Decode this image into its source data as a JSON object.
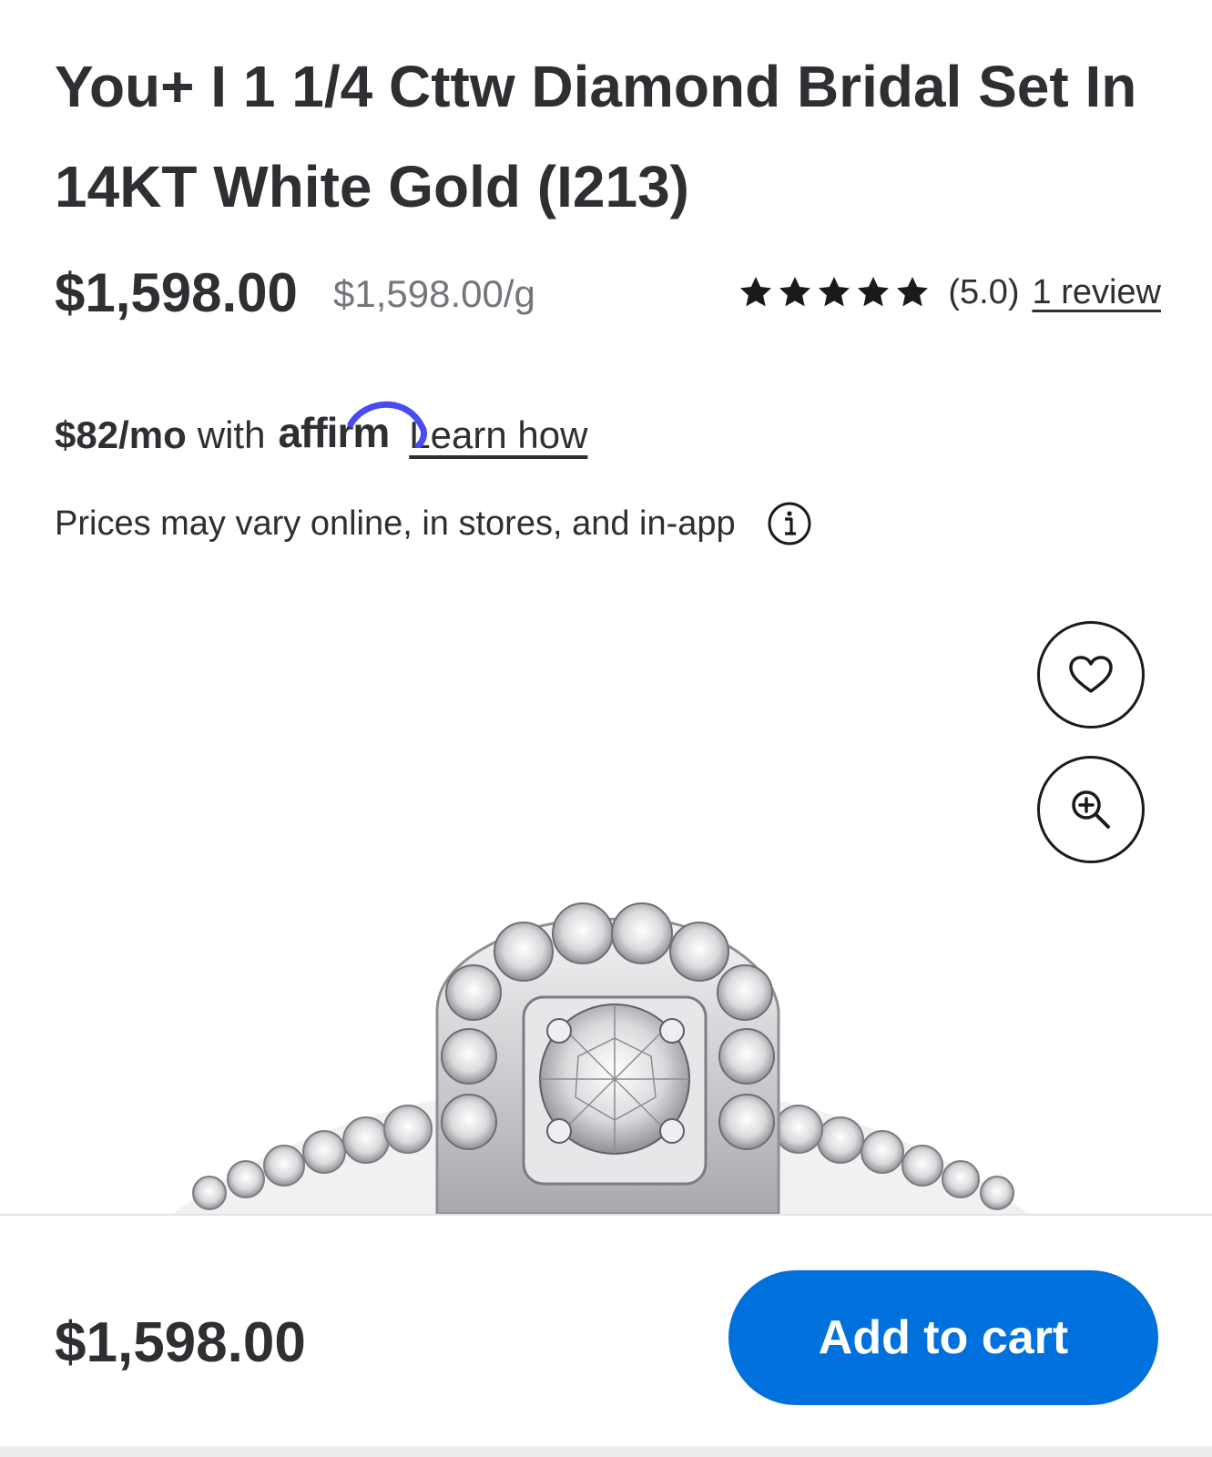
{
  "product": {
    "title": "You+ I 1 1/4 Cttw Diamond Bridal Set In 14KT White Gold (I213)",
    "price": "$1,598.00",
    "unit_price": "$1,598.00/g"
  },
  "rating": {
    "stars": 5,
    "max_stars": 5,
    "value_text": "(5.0)",
    "review_link": "1 review"
  },
  "financing": {
    "amount": "$82/mo",
    "with": "with",
    "provider": "affirm",
    "learn_link": "Learn how"
  },
  "disclaimer": {
    "text": "Prices may vary online, in stores, and in-app",
    "icon": "info-icon"
  },
  "image_actions": {
    "favorite_icon": "heart-icon",
    "zoom_icon": "zoom-in-icon"
  },
  "bottom_bar": {
    "price": "$1,598.00",
    "cart_label": "Add to cart"
  },
  "colors": {
    "primary_button": "#0071dc",
    "affirm_arc": "#4a4af4",
    "text": "#2e2f32",
    "muted_text": "#74767c"
  }
}
